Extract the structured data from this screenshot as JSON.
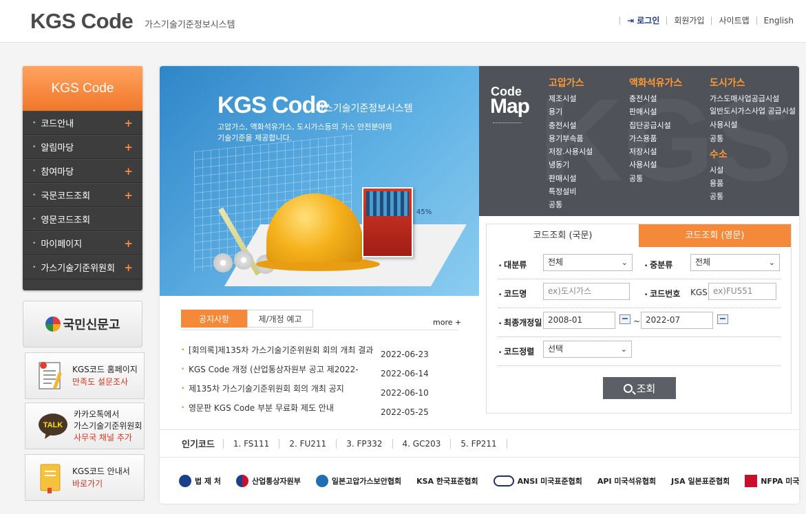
{
  "header": {
    "logo": "KGS Code",
    "logo_sub": "가스기술기준정보시스템",
    "nav": {
      "login": "로그인",
      "join": "회원가입",
      "sitemap": "사이트맵",
      "english": "English"
    }
  },
  "sidebar": {
    "title": "KGS Code",
    "items": [
      {
        "label": "코드안내",
        "plus": "+"
      },
      {
        "label": "알림마당",
        "plus": "+"
      },
      {
        "label": "참여마당",
        "plus": "+"
      },
      {
        "label": "국문코드조회",
        "plus": "+"
      },
      {
        "label": "영문코드조회",
        "plus": ""
      },
      {
        "label": "마이페이지",
        "plus": "+"
      },
      {
        "label": "가스기술기준위원회",
        "plus": "+"
      }
    ]
  },
  "left_banners": {
    "sinmungo": "국민신문고",
    "survey": {
      "line1": "KGS코드 홈페이지",
      "line2": "만족도 설문조사"
    },
    "kakao": {
      "badge": "TALK",
      "line1": "카카오톡에서",
      "line2": "가스기술기준위원회",
      "line3": "사무국 채널 추가"
    },
    "guide": {
      "line1": "KGS코드 안내서",
      "line2": "바로가기"
    }
  },
  "visual": {
    "title": "KGS Code",
    "subtitle": "가스기술기준정보시스템",
    "desc_line1": "고압가스, 액화석유가스, 도시가스등의 가스 안전분야의",
    "desc_line2": "기술기준을 제공합니다.",
    "percent": "45%"
  },
  "codemap": {
    "title1": "Code",
    "title2": "Map",
    "col1": {
      "heading": "고압가스",
      "items": [
        "제조시설",
        "용기",
        "충전시설",
        "용기부속품",
        "저장.사용시설",
        "냉동기",
        "판매시설",
        "특정설비",
        "공통"
      ]
    },
    "col2": {
      "heading": "액화석유가스",
      "items": [
        "충전시설",
        "판매시설",
        "집단공급시설",
        "가스용품",
        "저장시설",
        "사용시설",
        "공통"
      ]
    },
    "col3": {
      "heading": "도시가스",
      "items": [
        "가스도매사업공급시설",
        "일반도시가스사업 공급시설",
        "사용시설",
        "공통"
      ]
    },
    "col4": {
      "heading": "수소",
      "items": [
        "시설",
        "용품",
        "공통"
      ]
    }
  },
  "search": {
    "tab_kr": "코드조회 (국문)",
    "tab_en": "코드조회 (영문)",
    "category_label": "대분류",
    "category_value": "전체",
    "subcategory_label": "중분류",
    "subcategory_value": "전체",
    "code_name_label": "코드명",
    "code_name_placeholder": "ex)도시가스",
    "code_no_label": "코드번호",
    "code_no_prefix": "KGS",
    "code_no_placeholder": "ex)FU551",
    "revision_label": "최종개정일",
    "date_from": "2008-01",
    "date_tilde": "~",
    "date_to": "2022-07",
    "sort_label": "코드정렬",
    "sort_value": "선택",
    "button": "조회"
  },
  "notice": {
    "tab_notice": "공지사항",
    "tab_revision": "제/개정 예고",
    "more": "more +",
    "items": [
      {
        "title": "[회의록]제135차 가스기술기준위원회 회의 개최 결과",
        "date": "2022-06-23"
      },
      {
        "title": "KGS Code 개정 (산업통상자원부 공고 제2022-",
        "date": "2022-06-14"
      },
      {
        "title": "제135차 가스기술기준위원회 회의 개최 공지",
        "date": "2022-06-10"
      },
      {
        "title": "영문판 KGS Code 부분 무료화 제도 안내",
        "date": "2022-05-25"
      }
    ]
  },
  "popular": {
    "title": "인기코드",
    "items": [
      "1. FS111",
      "2. FU211",
      "3. FP332",
      "4. GC203",
      "5. FP211"
    ]
  },
  "orgs": [
    {
      "name": "법 제 처",
      "color": "#1b3f8b"
    },
    {
      "name": "산업통상자원부",
      "color": "#c8102e"
    },
    {
      "name": "일본고압가스보안협회",
      "color": "#1f6fb2"
    },
    {
      "name": "KSA 한국표준협회",
      "color": "#16337a"
    },
    {
      "name": "ANSI 미국표준협회",
      "color": "#1d2f6e"
    },
    {
      "name": "API 미국석유협회",
      "color": "#d21f26"
    },
    {
      "name": "JSA 일본표준협회",
      "color": "#1b4aa0"
    },
    {
      "name": "NFPA 미국방재협회",
      "color": "#c8102e"
    }
  ]
}
